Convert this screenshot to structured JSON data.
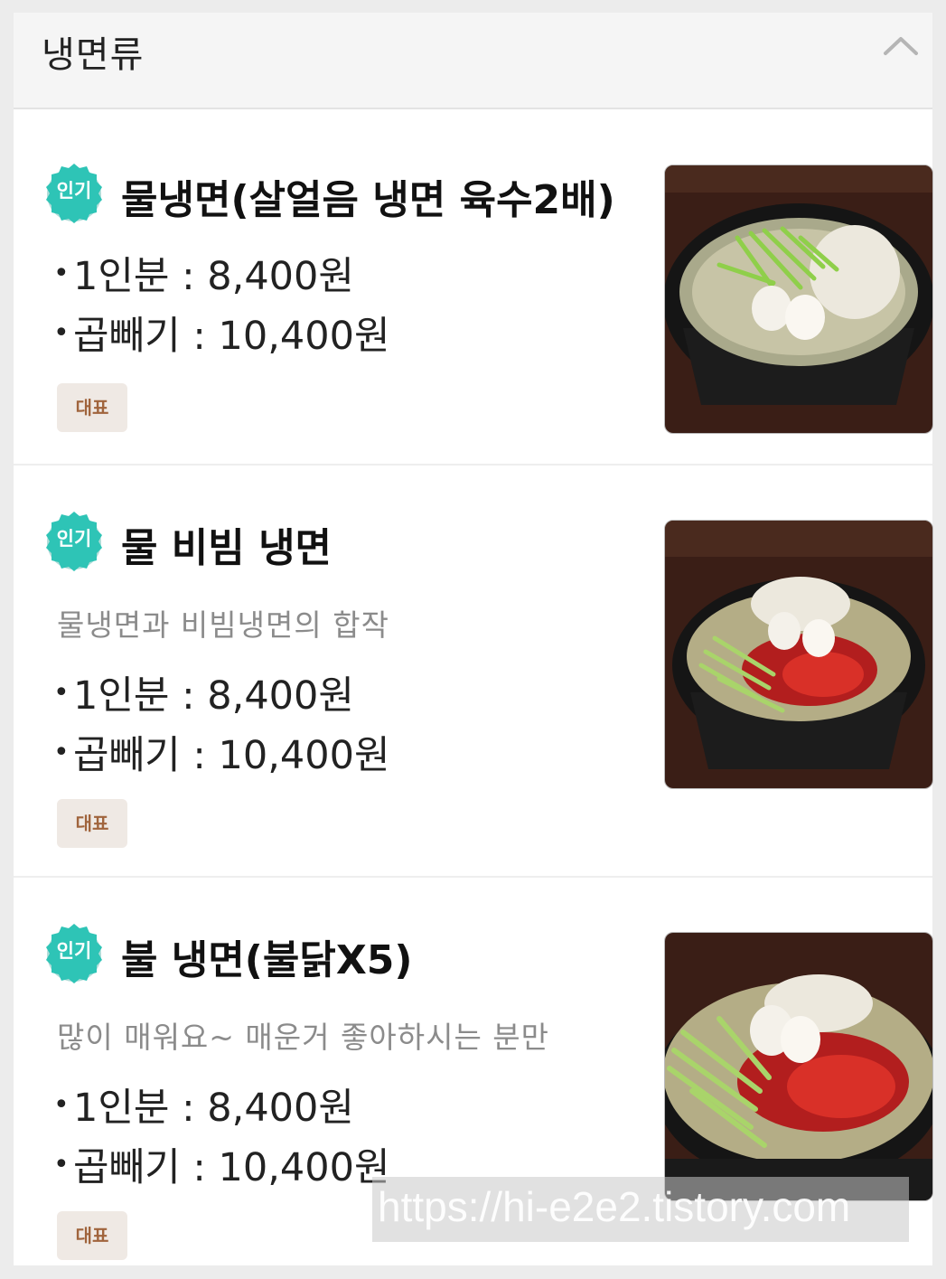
{
  "section": {
    "title": "냉면류",
    "collapse_icon": "chevron-up-icon"
  },
  "items": [
    {
      "badge": "인기",
      "name": "물냉면(살얼음 냉면 육수2배)",
      "description": "",
      "prices": [
        {
          "label": "1인분",
          "value": "8,400원",
          "text": "1인분 : 8,400원"
        },
        {
          "label": "곱빼기",
          "value": "10,400원",
          "text": "곱빼기 : 10,400원"
        }
      ],
      "tag": "대표",
      "image": "mul-naengmyeon-photo"
    },
    {
      "badge": "인기",
      "name": "물 비빔 냉면",
      "description": "물냉면과 비빔냉면의 합작",
      "prices": [
        {
          "label": "1인분",
          "value": "8,400원",
          "text": "1인분 : 8,400원"
        },
        {
          "label": "곱빼기",
          "value": "10,400원",
          "text": "곱빼기 : 10,400원"
        }
      ],
      "tag": "대표",
      "image": "mul-bibim-naengmyeon-photo"
    },
    {
      "badge": "인기",
      "name": "불 냉면(불닭X5)",
      "description": "많이 매워요~ 매운거 좋아하시는 분만",
      "prices": [
        {
          "label": "1인분",
          "value": "8,400원",
          "text": "1인분 : 8,400원"
        },
        {
          "label": "곱빼기",
          "value": "10,400원",
          "text": "곱빼기 : 10,400원"
        }
      ],
      "tag": "대표",
      "image": "bul-naengmyeon-photo"
    }
  ],
  "watermark": "https://hi-e2e2.tistory.com",
  "colors": {
    "badge_teal": "#2ec4b6",
    "tag_bg": "#efe9e4",
    "tag_text": "#a0643c",
    "description_gray": "#8b8b8b"
  }
}
